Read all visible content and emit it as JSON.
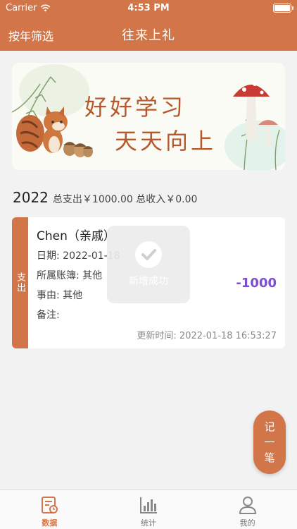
{
  "status_bar": {
    "carrier": "Carrier",
    "time": "4:53 PM"
  },
  "nav": {
    "filter_label": "按年筛选",
    "title": "往来上礼"
  },
  "banner": {
    "line1": "好好学习",
    "line2": "天天向上"
  },
  "summary": {
    "year": "2022",
    "totals": "总支出￥1000.00 总收入￥0.00"
  },
  "record": {
    "type": "支出",
    "name": "Chen（亲戚）",
    "date": "日期: 2022-01-18",
    "account": "所属账簿: 其他",
    "reason": "事由: 其他",
    "note": "备注:",
    "amount": "-1000",
    "updated": "更新时间: 2022-01-18 16:53:27"
  },
  "toast": {
    "message": "新增成功"
  },
  "fab": {
    "line1": "记",
    "line2": "一",
    "line3": "笔"
  },
  "tabs": [
    {
      "label": "数据",
      "icon": "data-icon",
      "active": true
    },
    {
      "label": "统计",
      "icon": "chart-icon",
      "active": false
    },
    {
      "label": "我的",
      "icon": "user-icon",
      "active": false
    }
  ],
  "colors": {
    "primary": "#d2764a",
    "amount": "#7b4fcf",
    "background": "#f2f2f2"
  }
}
